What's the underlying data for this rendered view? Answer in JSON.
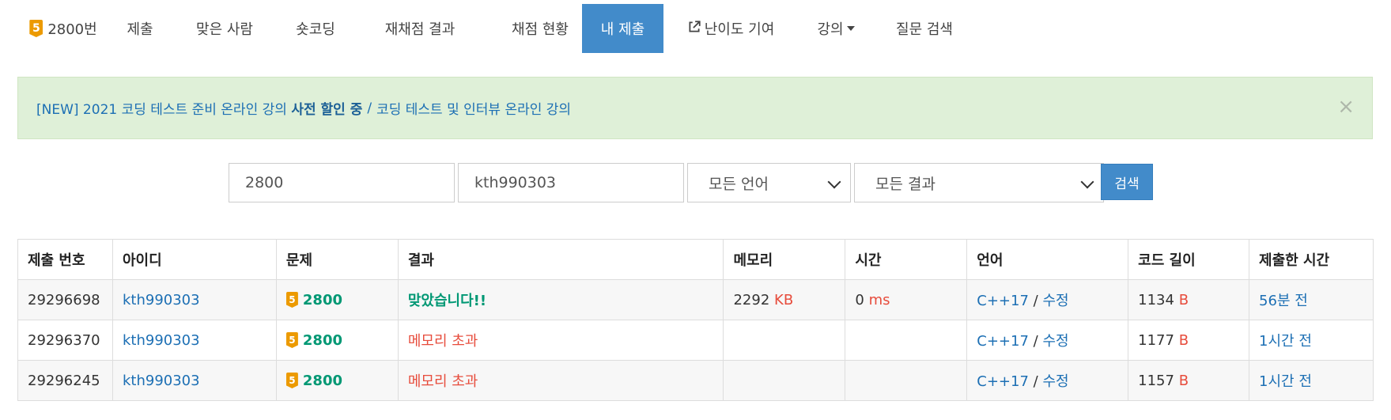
{
  "nav": {
    "tier": "5",
    "items": [
      {
        "label": "2800번"
      },
      {
        "label": "제출"
      },
      {
        "label": "맞은 사람"
      },
      {
        "label": "숏코딩"
      },
      {
        "label": "재채점 결과"
      },
      {
        "label": "채점 현황"
      },
      {
        "label": "내 제출"
      },
      {
        "label": "난이도 기여"
      },
      {
        "label": "강의"
      },
      {
        "label": "질문 검색"
      }
    ],
    "active_index": 6
  },
  "alert": {
    "prefix": "[NEW] 2021 코딩 테스트 준비 온라인 강의",
    "bold": "사전 할인 중",
    "separator": "/",
    "link2": "코딩 테스트 및 인터뷰 온라인 강의",
    "close": "×"
  },
  "search": {
    "problem_id": "2800",
    "user_id": "kth990303",
    "language": "모든 언어",
    "result": "모든 결과",
    "button": "검색"
  },
  "table": {
    "headers": [
      "제출 번호",
      "아이디",
      "문제",
      "결과",
      "메모리",
      "시간",
      "언어",
      "코드 길이",
      "제출한 시간"
    ],
    "rows": [
      {
        "id": "29296698",
        "user": "kth990303",
        "tier": "5",
        "problem": "2800",
        "result": "맞았습니다!!",
        "result_type": "ac",
        "memory": "2292",
        "memory_unit": "KB",
        "time": "0",
        "time_unit": "ms",
        "lang": "C++17",
        "sep": "/",
        "edit": "수정",
        "code_len": "1134",
        "code_unit": "B",
        "submitted": "56분 전"
      },
      {
        "id": "29296370",
        "user": "kth990303",
        "tier": "5",
        "problem": "2800",
        "result": "메모리 초과",
        "result_type": "mle",
        "memory": "",
        "memory_unit": "",
        "time": "",
        "time_unit": "",
        "lang": "C++17",
        "sep": "/",
        "edit": "수정",
        "code_len": "1177",
        "code_unit": "B",
        "submitted": "1시간 전"
      },
      {
        "id": "29296245",
        "user": "kth990303",
        "tier": "5",
        "problem": "2800",
        "result": "메모리 초과",
        "result_type": "mle",
        "memory": "",
        "memory_unit": "",
        "time": "",
        "time_unit": "",
        "lang": "C++17",
        "sep": "/",
        "edit": "수정",
        "code_len": "1157",
        "code_unit": "B",
        "submitted": "1시간 전"
      }
    ]
  }
}
